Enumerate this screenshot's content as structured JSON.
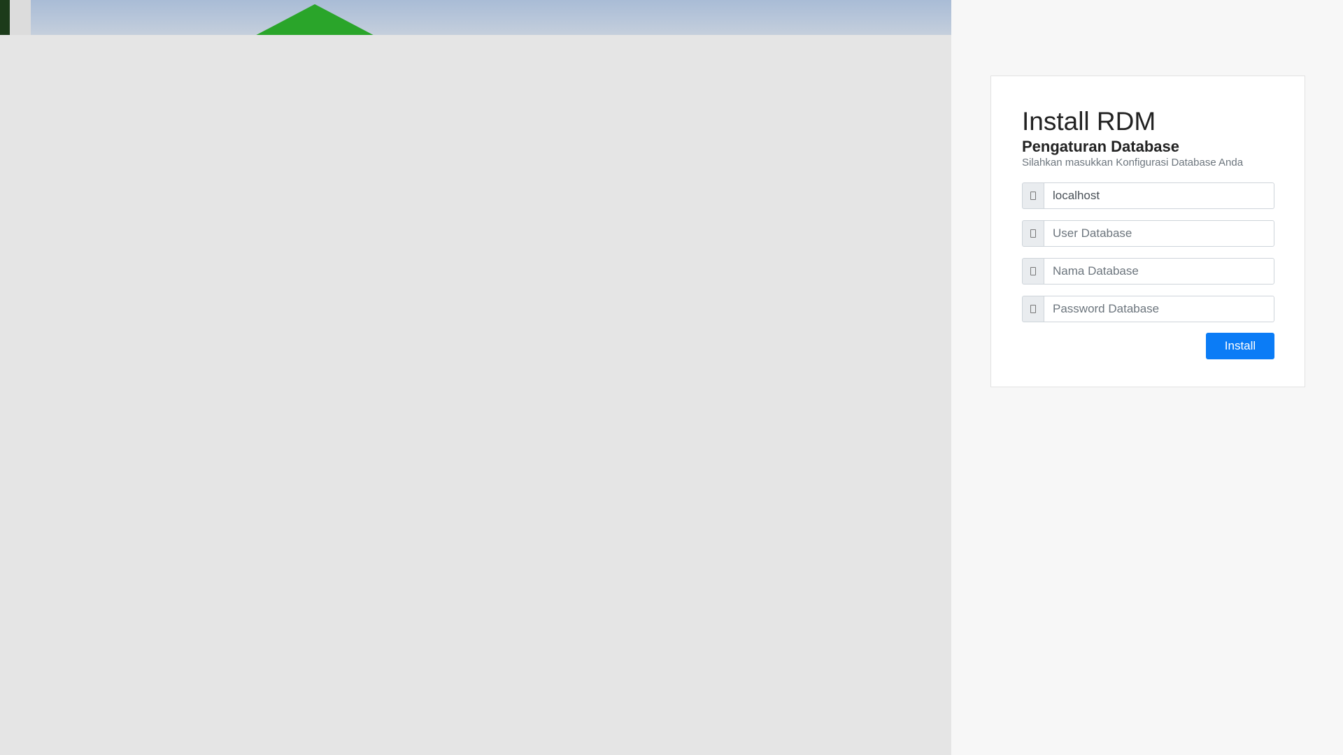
{
  "form": {
    "title": "Install RDM",
    "subtitle": "Pengaturan Database",
    "hint": "Silahkan masukkan Konfigurasi Database Anda",
    "fields": [
      {
        "icon": "server-icon",
        "value": "localhost",
        "placeholder": ""
      },
      {
        "icon": "user-icon",
        "value": "",
        "placeholder": "User Database"
      },
      {
        "icon": "database-icon",
        "value": "",
        "placeholder": "Nama Database"
      },
      {
        "icon": "lock-icon",
        "value": "",
        "placeholder": "Password Database"
      }
    ],
    "install_label": "Install"
  },
  "colors": {
    "accent": "#0b7cf6",
    "left_background": "#e5e5e5",
    "right_background": "#f7f7f7"
  }
}
